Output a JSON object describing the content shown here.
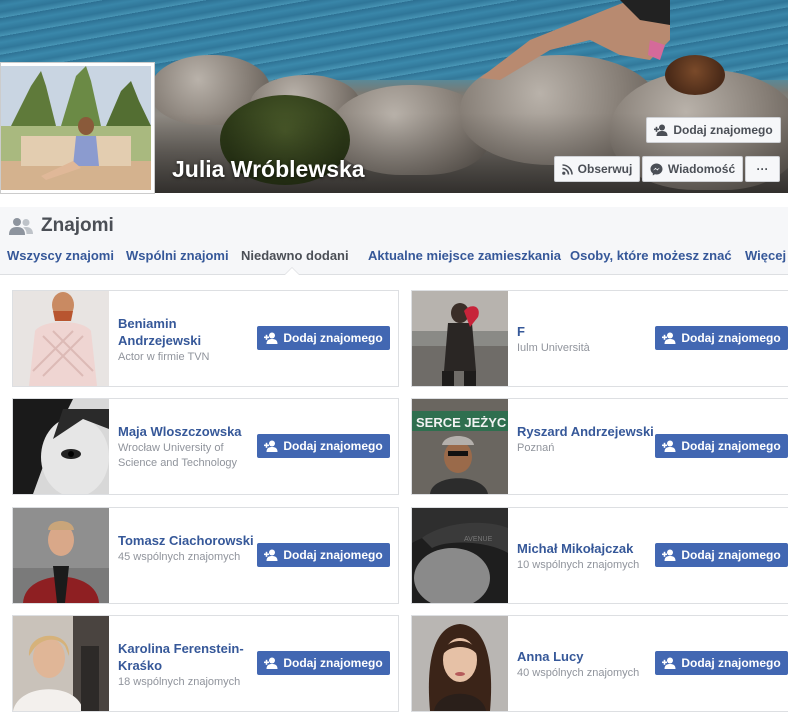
{
  "profile": {
    "name": "Julia Wróblewska",
    "add_friend_label": "Dodaj znajomego",
    "follow_label": "Obserwuj",
    "message_label": "Wiadomość",
    "more_label": "···"
  },
  "friends": {
    "title": "Znajomi",
    "tabs": [
      {
        "label": "Wszyscy znajomi"
      },
      {
        "label": "Wspólni znajomi"
      },
      {
        "label": "Niedawno dodani"
      },
      {
        "label": "Aktualne miejsce zamieszkania"
      },
      {
        "label": "Osoby, które możesz znać"
      },
      {
        "label": "Więcej"
      }
    ],
    "active_tab": "Niedawno dodani",
    "add_button_label": "Dodaj znajomego",
    "people": [
      {
        "name": "Beniamin Andrzejewski",
        "sub": "Actor w firmie TVN"
      },
      {
        "name": "F",
        "sub": "Iulm Università"
      },
      {
        "name": "Maja Wloszczowska",
        "sub": "Wrocław University of Science and Technology"
      },
      {
        "name": "Ryszard Andrzejewski",
        "sub": "Poznań"
      },
      {
        "name": "Tomasz Ciachorowski",
        "sub": "45 wspólnych znajomych"
      },
      {
        "name": "Michał Mikołajczak",
        "sub": "10 wspólnych znajomych"
      },
      {
        "name": "Karolina Ferenstein-Kraśko",
        "sub": "18 wspólnych znajomych"
      },
      {
        "name": "Anna Lucy",
        "sub": "40 wspólnych znajomych"
      }
    ]
  },
  "colors": {
    "link": "#365899",
    "primary_button": "#4267b2",
    "muted_text": "#90949c",
    "header_bg": "#f6f7f9"
  },
  "icons": {
    "add_friend": "add-friend-icon",
    "follow": "rss-icon",
    "message": "messenger-icon",
    "friends": "friends-icon"
  }
}
